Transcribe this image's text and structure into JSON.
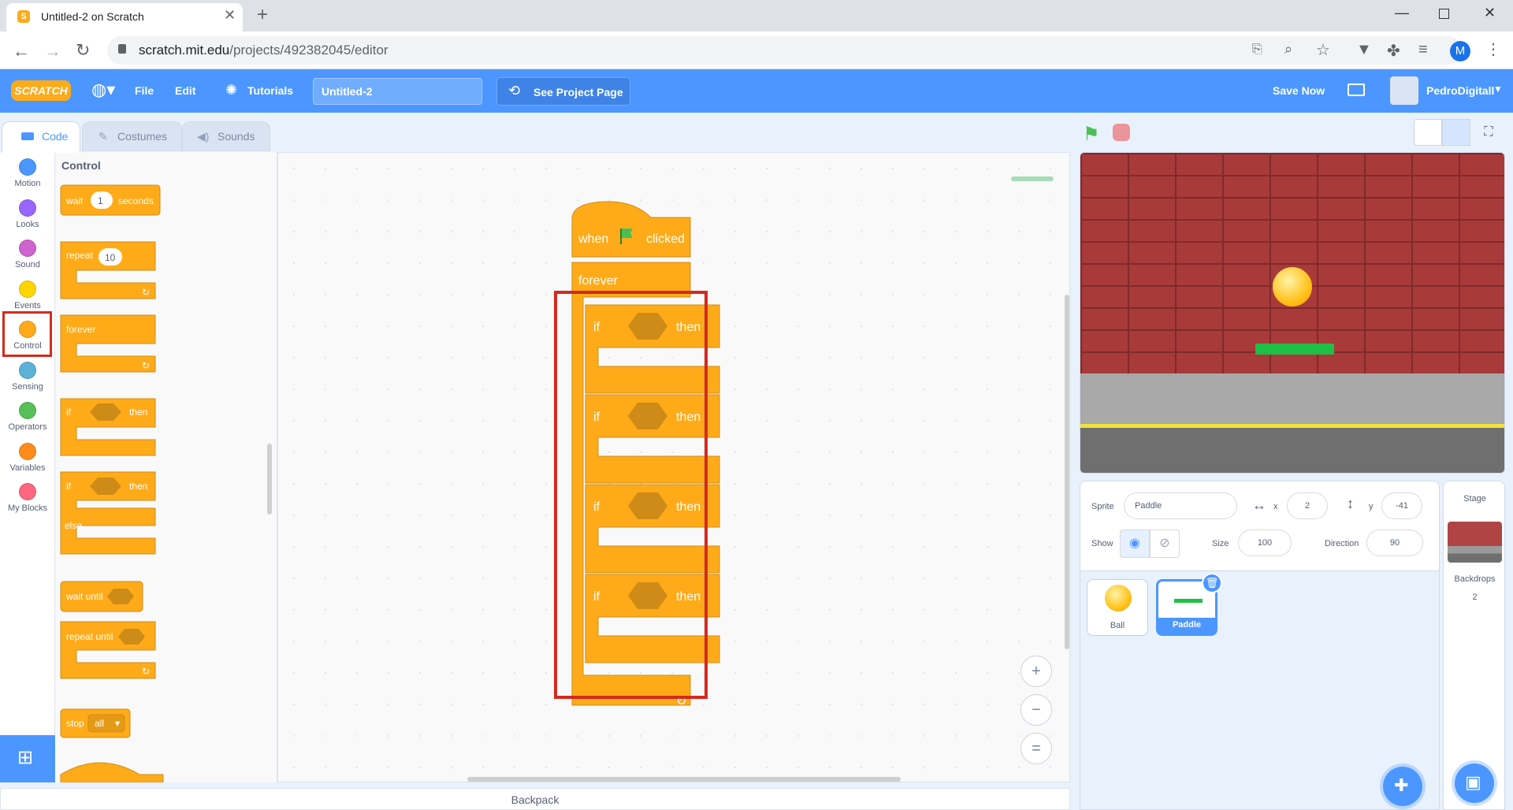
{
  "browser": {
    "tab_title": "Untitled-2 on Scratch",
    "url_host": "scratch.mit.edu",
    "url_path": "/projects/492382045/editor",
    "profile_initial": "M"
  },
  "menu": {
    "logo": "SCRATCH",
    "file": "File",
    "edit": "Edit",
    "tutorials": "Tutorials",
    "project_title": "Untitled-2",
    "see_project_page": "See Project Page",
    "save_now": "Save Now",
    "username": "PedroDigitall"
  },
  "editor_tabs": {
    "code": "Code",
    "costumes": "Costumes",
    "sounds": "Sounds"
  },
  "categories": [
    {
      "label": "Motion",
      "color": "#4c97ff"
    },
    {
      "label": "Looks",
      "color": "#9966ff"
    },
    {
      "label": "Sound",
      "color": "#cf63cf"
    },
    {
      "label": "Events",
      "color": "#ffd500"
    },
    {
      "label": "Control",
      "color": "#ffab19"
    },
    {
      "label": "Sensing",
      "color": "#5cb1d6"
    },
    {
      "label": "Operators",
      "color": "#59c059"
    },
    {
      "label": "Variables",
      "color": "#ff8c1a"
    },
    {
      "label": "My Blocks",
      "color": "#ff6680"
    }
  ],
  "palette": {
    "heading": "Control",
    "wait": "wait",
    "wait_value": "1",
    "seconds": "seconds",
    "repeat": "repeat",
    "repeat_value": "10",
    "forever": "forever",
    "if": "if",
    "then": "then",
    "else": "else",
    "wait_until": "wait until",
    "repeat_until": "repeat until",
    "stop": "stop",
    "stop_value": "all"
  },
  "script": {
    "hat_when": "when",
    "hat_clicked": "clicked",
    "forever": "forever",
    "if": "if",
    "then": "then"
  },
  "backpack": "Backpack",
  "sprite_info": {
    "sprite_label": "Sprite",
    "sprite_name": "Paddle",
    "x_label": "x",
    "x_value": "2",
    "y_label": "y",
    "y_value": "-41",
    "show_label": "Show",
    "size_label": "Size",
    "size_value": "100",
    "direction_label": "Direction",
    "direction_value": "90"
  },
  "sprites": [
    {
      "name": "Ball"
    },
    {
      "name": "Paddle",
      "selected": true
    }
  ],
  "stage_panel": {
    "title": "Stage",
    "backdrops_label": "Backdrops",
    "backdrops_count": "2"
  },
  "colors": {
    "scratch_blue": "#4c97ff",
    "control": "#ffab19",
    "highlight": "#d42a1e"
  }
}
